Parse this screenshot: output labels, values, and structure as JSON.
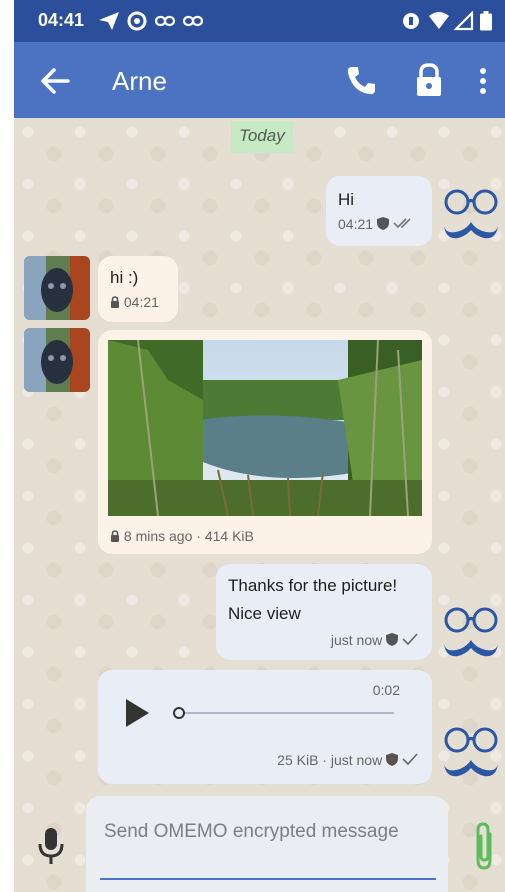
{
  "status_bar": {
    "time": "04:41"
  },
  "toolbar": {
    "title": "Arne"
  },
  "chat": {
    "date_separator": "Today",
    "messages": [
      {
        "direction": "out",
        "text": "Hi",
        "meta": "04:21"
      },
      {
        "direction": "in",
        "text": "hi :)",
        "meta": "04:21"
      },
      {
        "direction": "in",
        "type": "image",
        "meta": "8 mins ago · 414 KiB"
      },
      {
        "direction": "out",
        "text_line1": "Thanks for the picture!",
        "text_line2": "Nice view",
        "meta": "just now"
      },
      {
        "direction": "out",
        "type": "audio",
        "duration": "0:02",
        "progress": 0,
        "meta": "25 KiB · just now"
      }
    ]
  },
  "input": {
    "placeholder": "Send OMEMO encrypted message"
  },
  "colors": {
    "status_bar": "#2c4f9c",
    "toolbar": "#4b73c2",
    "attach": "#5cbb5a",
    "avatar_glasses": "#2c57a5"
  },
  "icons": [
    "send-icon",
    "data-saver-icon",
    "link-icon",
    "vpn-key-icon",
    "wifi-icon",
    "signal-icon",
    "battery-icon",
    "back-arrow-icon",
    "phone-icon",
    "lock-icon",
    "more-vert-icon",
    "shield-icon",
    "double-check-icon",
    "check-icon",
    "play-icon",
    "mic-icon",
    "paperclip-icon"
  ]
}
